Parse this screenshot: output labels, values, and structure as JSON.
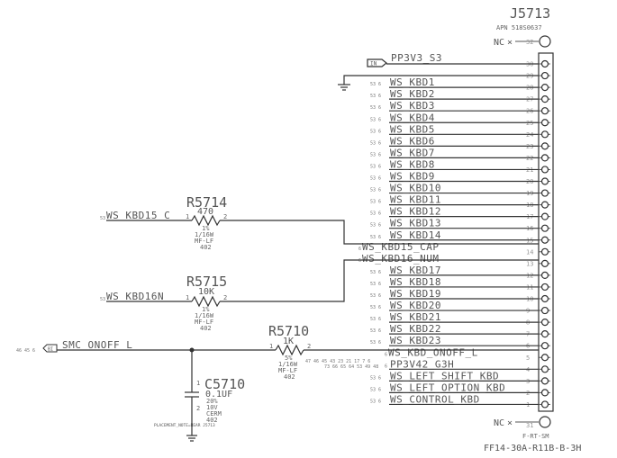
{
  "connector": {
    "ref": "J5713",
    "apn": "APN 518S0637",
    "footprint": "F-RT-SM",
    "part_number": "FF14-30A-R11B-B-3H",
    "nc_label": "NC",
    "nc_pins": [
      "32",
      "31"
    ]
  },
  "pins": [
    {
      "pin": "30",
      "net": "PP3V3_S3",
      "refs": "",
      "kind": "power-in"
    },
    {
      "pin": "29",
      "net": "",
      "refs": "",
      "kind": "ground"
    },
    {
      "pin": "28",
      "net": "WS_KBD1",
      "refs": "53 6"
    },
    {
      "pin": "27",
      "net": "WS_KBD2",
      "refs": "53 6"
    },
    {
      "pin": "26",
      "net": "WS_KBD3",
      "refs": "53 6"
    },
    {
      "pin": "25",
      "net": "WS_KBD4",
      "refs": "53 6"
    },
    {
      "pin": "24",
      "net": "WS_KBD5",
      "refs": "53 6"
    },
    {
      "pin": "23",
      "net": "WS_KBD6",
      "refs": "53 6"
    },
    {
      "pin": "22",
      "net": "WS_KBD7",
      "refs": "53 6"
    },
    {
      "pin": "21",
      "net": "WS_KBD8",
      "refs": "53 6"
    },
    {
      "pin": "20",
      "net": "WS_KBD9",
      "refs": "53 6"
    },
    {
      "pin": "19",
      "net": "WS_KBD10",
      "refs": "53 6"
    },
    {
      "pin": "18",
      "net": "WS_KBD11",
      "refs": "53 6"
    },
    {
      "pin": "17",
      "net": "WS_KBD12",
      "refs": "53 6"
    },
    {
      "pin": "16",
      "net": "WS_KBD13",
      "refs": "53 6"
    },
    {
      "pin": "15",
      "net": "WS_KBD14",
      "refs": "53 6"
    },
    {
      "pin": "14",
      "net": "WS_KBD15_CAP",
      "refs": "6"
    },
    {
      "pin": "13",
      "net": "WS_KBD16_NUM",
      "refs": "6"
    },
    {
      "pin": "12",
      "net": "WS_KBD17",
      "refs": "53 6"
    },
    {
      "pin": "11",
      "net": "WS_KBD18",
      "refs": "53 6"
    },
    {
      "pin": "10",
      "net": "WS_KBD19",
      "refs": "53 6"
    },
    {
      "pin": "9",
      "net": "WS_KBD20",
      "refs": "53 6"
    },
    {
      "pin": "8",
      "net": "WS_KBD21",
      "refs": "53 6"
    },
    {
      "pin": "7",
      "net": "WS_KBD22",
      "refs": "53 6"
    },
    {
      "pin": "6",
      "net": "WS_KBD23",
      "refs": "53 6"
    },
    {
      "pin": "5",
      "net": "WS_KBD_ONOFF_L",
      "refs": "6"
    },
    {
      "pin": "4",
      "net": "PP3V42_G3H",
      "refs": "6"
    },
    {
      "pin": "3",
      "net": "WS_LEFT_SHIFT_KBD",
      "refs": "53 6"
    },
    {
      "pin": "2",
      "net": "WS_LEFT_OPTION_KBD",
      "refs": "53 6"
    },
    {
      "pin": "1",
      "net": "WS_CONTROL_KBD",
      "refs": "53 6"
    }
  ],
  "pp3v42_refs_top": "47 46 45 43 23 21 17 7 6",
  "pp3v42_refs_bottom": "73 66 65 64 53 49 48",
  "r5714": {
    "ref": "R5714",
    "value": "470",
    "tol": "1%",
    "power": "1/16W",
    "type": "MF-LF",
    "size": "402",
    "pin1": "1",
    "pin2": "2",
    "net_in": "WS_KBD15_C",
    "net_in_refs": "53"
  },
  "r5715": {
    "ref": "R5715",
    "value": "10K",
    "tol": "1%",
    "power": "1/16W",
    "type": "MF-LF",
    "size": "402",
    "pin1": "1",
    "pin2": "2",
    "net_in": "WS_KBD16N",
    "net_in_refs": "53"
  },
  "r5710": {
    "ref": "R5710",
    "value": "1K",
    "tol": "5%",
    "power": "1/16W",
    "type": "MF-LF",
    "size": "402",
    "pin1": "1",
    "pin2": "2"
  },
  "c5710": {
    "ref": "C5710",
    "value": "0.1UF",
    "tol": "20%",
    "voltage": "10V",
    "type": "CERM",
    "size": "402",
    "pin1": "1",
    "pin2": "2",
    "note": "PLACEMENT_NOTE=NEAR J5713"
  },
  "smc": {
    "net": "SMC_ONOFF_L",
    "refs": "46 45 6",
    "port_label": "BI"
  },
  "power_in_label": "IN"
}
